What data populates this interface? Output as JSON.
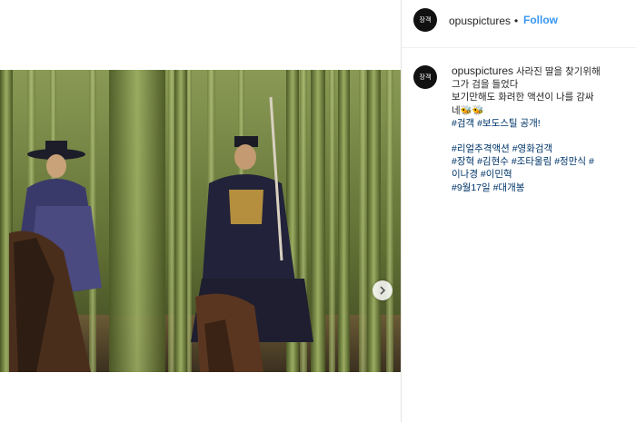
{
  "account": {
    "username": "opuspictures",
    "separator": "•",
    "follow_label": "Follow",
    "avatar_text": "장객"
  },
  "caption": {
    "username": "opuspictures",
    "first_line_text": "사라진 딸을 찾기위해",
    "lines": [
      "그가 검을 들었다",
      "보기만해도 화려한 액션이 나를 감싸",
      "네🐝🐝"
    ],
    "tag_line_1": "#검객 #보도스틸 공개!",
    "hashtag_lines": [
      "#리얼추격액션 #영화검객",
      "#장혁 #김현수 #조타울림 #정만식 #",
      "이나경 #이민혁",
      "#9월17일 #대개봉"
    ]
  },
  "media": {
    "description_icon": "photo",
    "next_icon": "chevron-right-icon"
  },
  "colors": {
    "link": "#3897f0",
    "hashtag": "#003569",
    "text": "#262626"
  }
}
